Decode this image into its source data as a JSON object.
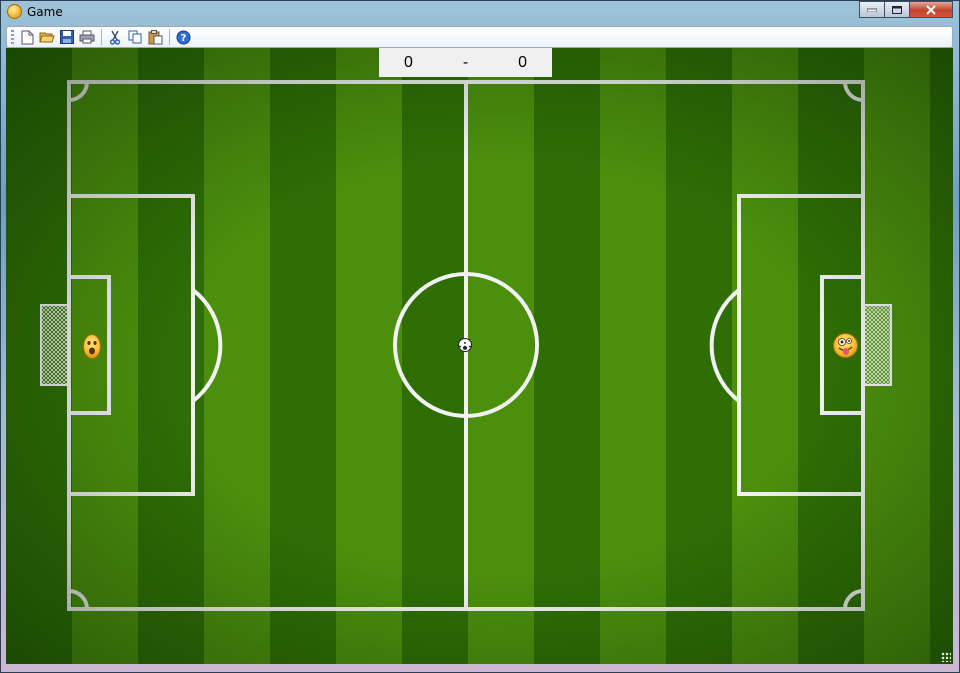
{
  "window": {
    "title": "Game"
  },
  "toolbar": {
    "buttons": [
      {
        "name": "new-icon"
      },
      {
        "name": "open-icon"
      },
      {
        "name": "save-icon"
      },
      {
        "name": "print-icon"
      },
      {
        "name": "cut-icon"
      },
      {
        "name": "copy-icon"
      },
      {
        "name": "paste-icon"
      },
      {
        "name": "help-icon"
      }
    ]
  },
  "score": {
    "left": "0",
    "separator": "-",
    "right": "0"
  },
  "colors": {
    "pitch_dark": "#2f6e05",
    "pitch_light": "#4c8f0d",
    "lines": "#f2f2f2",
    "scoreboard_bg": "#f0f0f0"
  }
}
